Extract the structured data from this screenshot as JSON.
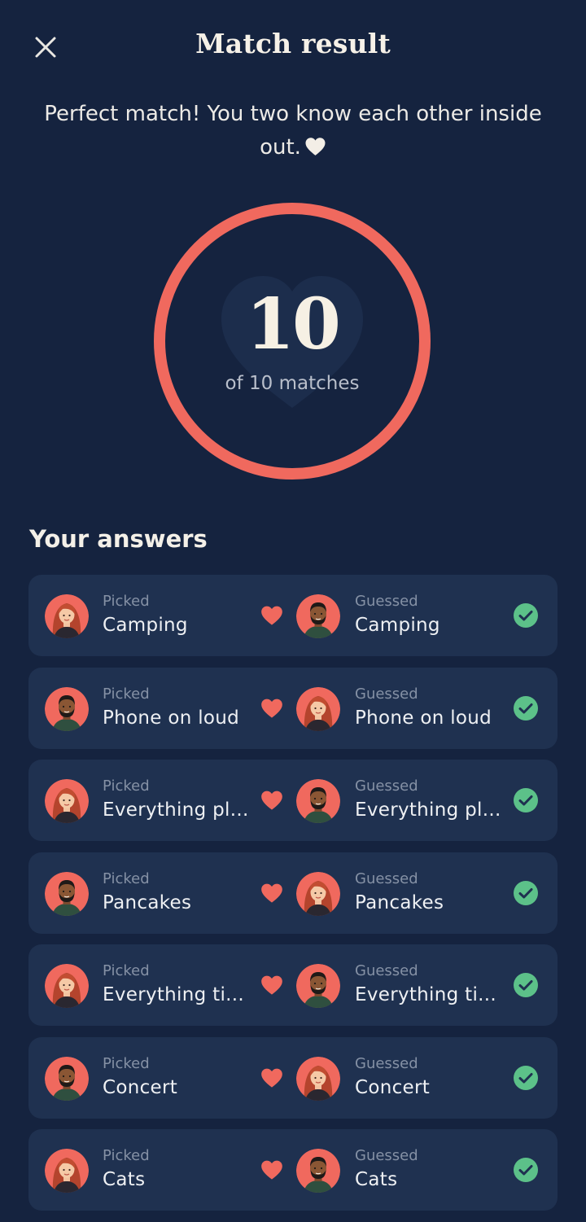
{
  "header": {
    "title": "Match result",
    "close_icon": "close-icon"
  },
  "result": {
    "message": "Perfect match! You two know each other inside out.",
    "score": "10",
    "caption": "of 10 matches",
    "score_fraction": 1.0
  },
  "answers": {
    "title": "Your answers",
    "rows": [
      {
        "picked_label": "Picked",
        "picked_value": "Camping",
        "picked_avatar": "avatar-woman",
        "guessed_label": "Guessed",
        "guessed_value": "Camping",
        "guessed_avatar": "avatar-man"
      },
      {
        "picked_label": "Picked",
        "picked_value": "Phone on loud",
        "picked_avatar": "avatar-man",
        "guessed_label": "Guessed",
        "guessed_value": "Phone on loud",
        "guessed_avatar": "avatar-woman"
      },
      {
        "picked_label": "Picked",
        "picked_value": "Everything pl...",
        "picked_avatar": "avatar-woman",
        "guessed_label": "Guessed",
        "guessed_value": "Everything pl...",
        "guessed_avatar": "avatar-man"
      },
      {
        "picked_label": "Picked",
        "picked_value": "Pancakes",
        "picked_avatar": "avatar-man",
        "guessed_label": "Guessed",
        "guessed_value": "Pancakes",
        "guessed_avatar": "avatar-woman"
      },
      {
        "picked_label": "Picked",
        "picked_value": "Everything ti...",
        "picked_avatar": "avatar-woman",
        "guessed_label": "Guessed",
        "guessed_value": "Everything ti...",
        "guessed_avatar": "avatar-man"
      },
      {
        "picked_label": "Picked",
        "picked_value": "Concert",
        "picked_avatar": "avatar-man",
        "guessed_label": "Guessed",
        "guessed_value": "Concert",
        "guessed_avatar": "avatar-woman"
      },
      {
        "picked_label": "Picked",
        "picked_value": "Cats",
        "picked_avatar": "avatar-woman",
        "guessed_label": "Guessed",
        "guessed_value": "Cats",
        "guessed_avatar": "avatar-man"
      }
    ]
  },
  "colors": {
    "background": "#15233f",
    "card": "#1f3150",
    "accent": "#f0695e",
    "success": "#5cc189"
  }
}
